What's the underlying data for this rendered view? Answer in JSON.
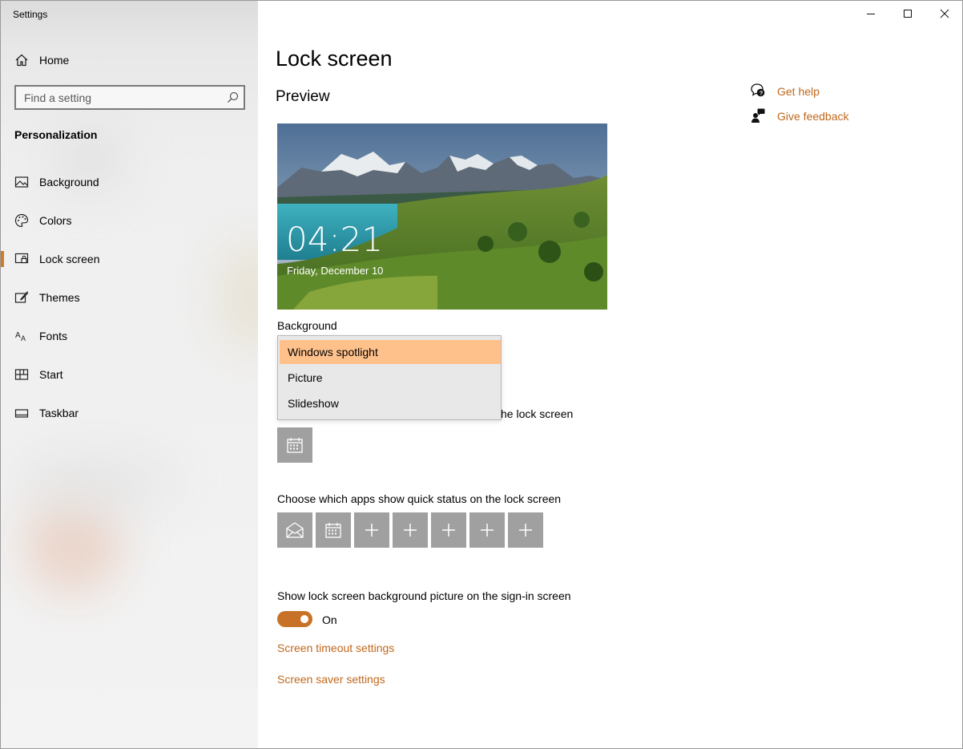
{
  "window": {
    "title": "Settings",
    "controls": [
      "minimize-icon",
      "maximize-icon",
      "close-icon"
    ]
  },
  "sidebar": {
    "home_label": "Home",
    "search": {
      "placeholder": "Find a setting",
      "value": ""
    },
    "section_title": "Personalization",
    "items": [
      {
        "label": "Background",
        "icon": "picture-icon",
        "selected": false
      },
      {
        "label": "Colors",
        "icon": "palette-icon",
        "selected": false
      },
      {
        "label": "Lock screen",
        "icon": "lock-screen-icon",
        "selected": true
      },
      {
        "label": "Themes",
        "icon": "themes-icon",
        "selected": false
      },
      {
        "label": "Fonts",
        "icon": "fonts-icon",
        "selected": false
      },
      {
        "label": "Start",
        "icon": "start-icon",
        "selected": false
      },
      {
        "label": "Taskbar",
        "icon": "taskbar-icon",
        "selected": false
      }
    ],
    "accent_color": "#d07a2c"
  },
  "main": {
    "page_title": "Lock screen",
    "preview_title": "Preview",
    "preview": {
      "time": "04:21",
      "date": "Friday, December 10"
    },
    "background": {
      "label": "Background",
      "options": [
        "Windows spotlight",
        "Picture",
        "Slideshow"
      ],
      "selected": "Windows spotlight"
    },
    "detailed_status_label_tail": "he lock screen",
    "detailed_status_app": "calendar-icon",
    "quick_status": {
      "label": "Choose which apps show quick status on the lock screen",
      "apps": [
        "mail-icon",
        "calendar-icon",
        "plus-icon",
        "plus-icon",
        "plus-icon",
        "plus-icon",
        "plus-icon"
      ]
    },
    "signin": {
      "label": "Show lock screen background picture on the sign-in screen",
      "toggle_state": "On",
      "toggle_on": true
    },
    "links": {
      "screen_timeout": "Screen timeout settings",
      "screen_saver": "Screen saver settings"
    },
    "link_color": "#c0681c"
  },
  "help": {
    "get_help": "Get help",
    "give_feedback": "Give feedback"
  }
}
